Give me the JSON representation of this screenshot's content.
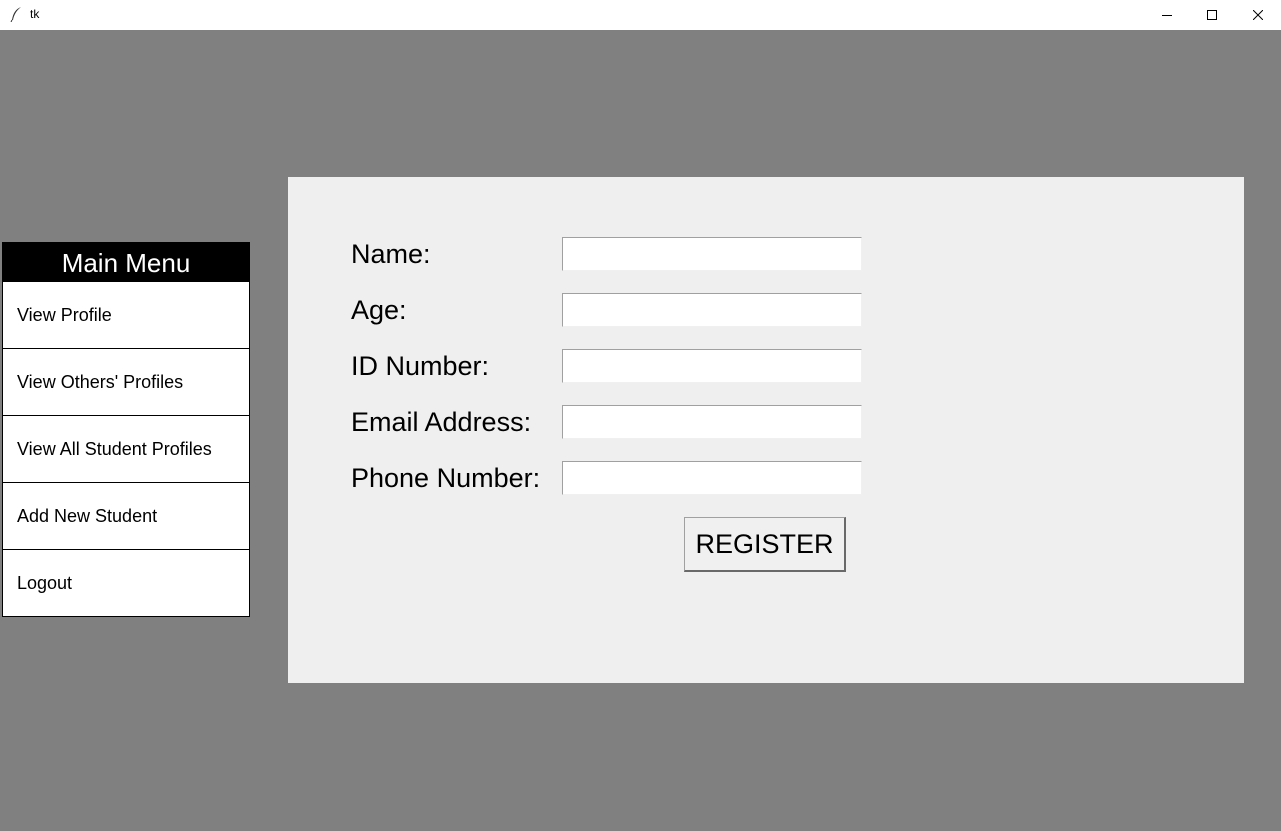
{
  "window": {
    "title": "tk",
    "icon": "tk-feather-icon"
  },
  "menu": {
    "header": "Main Menu",
    "items": [
      {
        "label": "View Profile"
      },
      {
        "label": "View Others' Profiles"
      },
      {
        "label": "View All Student Profiles"
      },
      {
        "label": "Add New Student"
      },
      {
        "label": "Logout"
      }
    ]
  },
  "form": {
    "fields": [
      {
        "label": "Name:",
        "value": ""
      },
      {
        "label": "Age:",
        "value": ""
      },
      {
        "label": "ID Number:",
        "value": ""
      },
      {
        "label": "Email Address:",
        "value": ""
      },
      {
        "label": "Phone Number:",
        "value": ""
      }
    ],
    "submit_label": "REGISTER"
  },
  "colors": {
    "background": "#808080",
    "panel": "#efefef",
    "menu_header_bg": "#000000",
    "menu_header_fg": "#ffffff"
  }
}
